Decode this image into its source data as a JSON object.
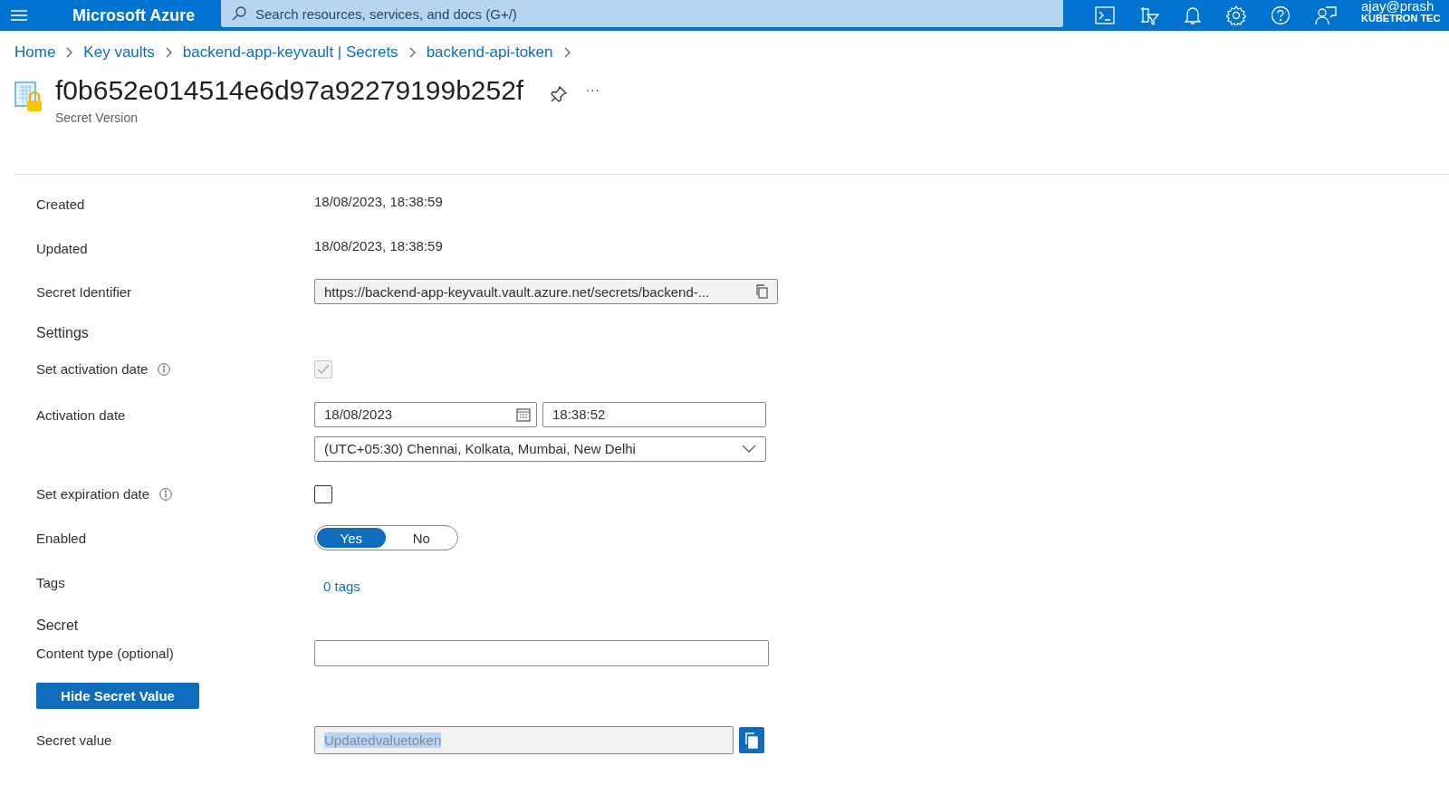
{
  "header": {
    "brand": "Microsoft Azure",
    "search": {
      "placeholder": "Search resources, services, and docs (G+/)"
    },
    "user": {
      "email": "ajay@prash",
      "org": "KUBETRON TEC"
    }
  },
  "breadcrumb": [
    "Home",
    "Key vaults",
    "backend-app-keyvault | Secrets",
    "backend-api-token"
  ],
  "page": {
    "title": "f0b652e014514e6d97a92279199b252f",
    "subtitle": "Secret Version",
    "more": "···"
  },
  "rows": [
    {
      "kind": "text",
      "label": "Created",
      "value": "18/08/2023, 18:38:59"
    },
    {
      "kind": "text",
      "label": "Updated",
      "value": "18/08/2023, 18:38:59"
    },
    {
      "kind": "readonly",
      "label": "Secret Identifier",
      "value": "https://backend-app-keyvault.vault.azure.net/secrets/backend-..."
    },
    {
      "kind": "section",
      "label": "Settings"
    },
    {
      "kind": "checkbox",
      "label": "Set activation date",
      "info": true,
      "checked": true,
      "disabled": true
    },
    {
      "kind": "datetime",
      "label": "Activation date",
      "date": "18/08/2023",
      "time": "18:38:52",
      "timezone": "(UTC+05:30) Chennai, Kolkata, Mumbai, New Delhi"
    },
    {
      "kind": "checkbox",
      "label": "Set expiration date",
      "info": true,
      "checked": false,
      "disabled": false
    },
    {
      "kind": "toggle",
      "label": "Enabled",
      "options": [
        {
          "label": "Yes",
          "selected": true
        },
        {
          "label": "No",
          "selected": false
        }
      ]
    },
    {
      "kind": "link",
      "label": "Tags",
      "value": "0 tags"
    },
    {
      "kind": "section",
      "label": "Secret"
    },
    {
      "kind": "input",
      "label": "Content type (optional)"
    },
    {
      "kind": "button",
      "label": "Hide Secret Value"
    },
    {
      "kind": "secret",
      "label": "Secret value",
      "value": "Updatedvaluetoken",
      "selected": true
    }
  ]
}
